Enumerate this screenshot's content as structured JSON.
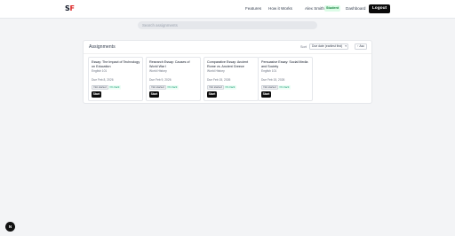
{
  "header": {
    "logo_s": "S",
    "logo_f": "F",
    "nav": [
      "Features",
      "How it Works"
    ],
    "user_name": "Alex Smith",
    "role": "Student",
    "dashboard": "Dashboard",
    "logout": "Logout"
  },
  "search": {
    "placeholder": "Search assignments"
  },
  "assignments": {
    "title": "Assignments",
    "sort_label": "Sort",
    "sort_value": "Due date (earliest first)",
    "sort_dir": "↑ Asc",
    "cards": [
      {
        "title": "Essay: The Impact of Technology on Education",
        "subject": "English 101",
        "due": "Due Feb 8, 2026",
        "status": "Not started",
        "time": "On track",
        "start": "Start"
      },
      {
        "title": "Research Essay: Causes of World War I",
        "subject": "World History",
        "due": "Due Feb 9, 2026",
        "status": "Not started",
        "time": "On track",
        "start": "Start"
      },
      {
        "title": "Comparative Essay: Ancient Rome vs. Ancient Greece",
        "subject": "World History",
        "due": "Due Feb 15, 2026",
        "status": "Not started",
        "time": "On track",
        "start": "Start"
      },
      {
        "title": "Persuasive Essay: Social Media and Society",
        "subject": "English 101",
        "due": "Due Feb 15, 2026",
        "status": "Not started",
        "time": "On track",
        "start": "Start"
      }
    ]
  },
  "fab": {
    "label": "N"
  },
  "colors": {
    "accent": "#dc2626",
    "primary": "#0a0a0a",
    "badge_green": "#dcfce7"
  }
}
